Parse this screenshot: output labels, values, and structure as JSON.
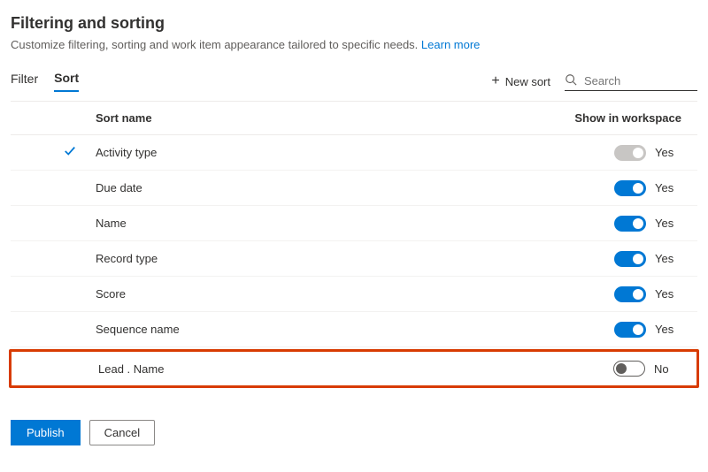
{
  "header": {
    "title": "Filtering and sorting",
    "subtitle": "Customize filtering, sorting and work item appearance tailored to specific needs.",
    "learn_more": "Learn more"
  },
  "tabs": {
    "filter": "Filter",
    "sort": "Sort"
  },
  "toolbar": {
    "new_sort": "New sort",
    "search_placeholder": "Search"
  },
  "table": {
    "col_sort_name": "Sort name",
    "col_show": "Show in workspace",
    "rows": [
      {
        "name": "Activity type",
        "checked": true,
        "toggle": "disabled",
        "toggle_label": "Yes"
      },
      {
        "name": "Due date",
        "checked": false,
        "toggle": "on",
        "toggle_label": "Yes"
      },
      {
        "name": "Name",
        "checked": false,
        "toggle": "on",
        "toggle_label": "Yes"
      },
      {
        "name": "Record type",
        "checked": false,
        "toggle": "on",
        "toggle_label": "Yes"
      },
      {
        "name": "Score",
        "checked": false,
        "toggle": "on",
        "toggle_label": "Yes"
      },
      {
        "name": "Sequence name",
        "checked": false,
        "toggle": "on",
        "toggle_label": "Yes"
      },
      {
        "name": "Lead . Name",
        "checked": false,
        "toggle": "off",
        "toggle_label": "No",
        "highlighted": true
      }
    ]
  },
  "actions": {
    "publish": "Publish",
    "cancel": "Cancel"
  }
}
